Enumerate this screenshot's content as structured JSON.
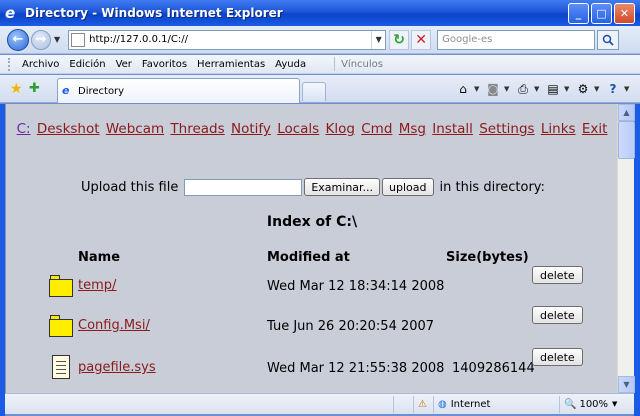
{
  "window": {
    "title": "Directory - Windows Internet Explorer",
    "minimize": "_",
    "maximize": "□",
    "close": "✕"
  },
  "toolbar": {
    "back": "←",
    "forward": "→",
    "address": "http://127.0.0.1/C://",
    "search_placeholder": "Google-es",
    "refresh": "↻",
    "stop": "✕"
  },
  "menu": {
    "items": [
      "Archivo",
      "Edición",
      "Ver",
      "Favoritos",
      "Herramientas",
      "Ayuda"
    ],
    "links_label": "Vínculos"
  },
  "tabs": [
    {
      "label": "Directory"
    }
  ],
  "nav_links": [
    "C:",
    "Deskshot",
    "Webcam",
    "Threads",
    "Notify",
    "Locals",
    "Klog",
    "Cmd",
    "Msg",
    "Install",
    "Settings",
    "Links",
    "Exit"
  ],
  "upload": {
    "label": "Upload this file",
    "browse_button": "Examinar...",
    "upload_button": "upload",
    "after": "in this directory:"
  },
  "index_title": "Index of C:\\",
  "columns": {
    "name": "Name",
    "modified": "Modified at",
    "size": "Size(bytes)"
  },
  "rows": [
    {
      "type": "folder",
      "name": "temp/",
      "modified": "Wed Mar 12 18:34:14 2008",
      "size": "",
      "action": "delete"
    },
    {
      "type": "folder",
      "name": "Config.Msi/",
      "modified": "Tue Jun 26 20:20:54 2007",
      "size": "",
      "action": "delete"
    },
    {
      "type": "file",
      "name": "pagefile.sys",
      "modified": "Wed Mar 12 21:55:38 2008",
      "size": "1409286144",
      "action": "delete"
    }
  ],
  "status": {
    "zone": "Internet",
    "zoom": "100%"
  }
}
